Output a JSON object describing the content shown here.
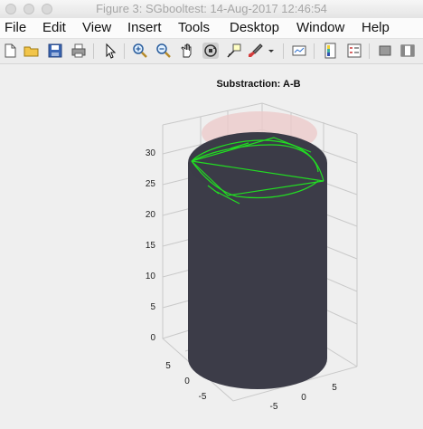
{
  "window": {
    "title": "Figure 3: SGbooltest: 14-Aug-2017 12:46:54"
  },
  "menu": [
    "File",
    "Edit",
    "View",
    "Insert",
    "Tools",
    "Desktop",
    "Window",
    "Help"
  ],
  "toolbar": {
    "icons": [
      "new-figure-icon",
      "open-file-icon",
      "save-icon",
      "print-icon",
      "pointer-icon",
      "zoom-in-icon",
      "zoom-out-icon",
      "pan-icon",
      "rotate-3d-icon",
      "data-cursor-icon",
      "brush-icon",
      "brush-dropdown-icon",
      "link-plot-icon",
      "colorbar-icon",
      "legend-icon",
      "hide-plot-tools-icon",
      "show-plot-tools-icon"
    ]
  },
  "chart_data": {
    "type": "3d-surface",
    "title": "Substraction: A-B",
    "z_ticks": [
      "0",
      "5",
      "10",
      "15",
      "20",
      "25",
      "30"
    ],
    "y_ticks": [
      "5",
      "0",
      "-5"
    ],
    "x_ticks": [
      "-5",
      "0",
      "5"
    ],
    "zlim": [
      0,
      33
    ],
    "grid": true,
    "colors": {
      "solid": "#3c3c48",
      "edges": "#22dd22",
      "ghost_top": "#e8c8c8",
      "axes_box": "#c8c8c8"
    }
  }
}
